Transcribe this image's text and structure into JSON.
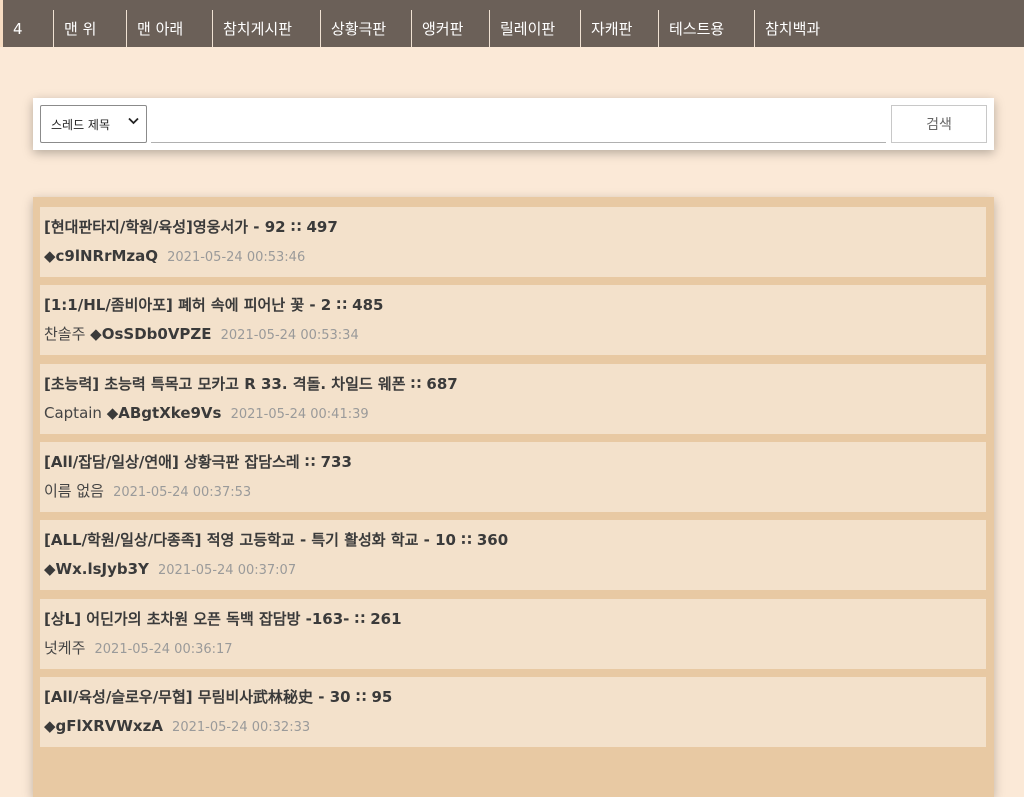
{
  "nav": {
    "items": [
      {
        "label": "4"
      },
      {
        "label": "맨 위"
      },
      {
        "label": "맨 아래"
      },
      {
        "label": "참치게시판"
      },
      {
        "label": "상황극판"
      },
      {
        "label": "앵커판"
      },
      {
        "label": "릴레이판"
      },
      {
        "label": "자캐판"
      },
      {
        "label": "테스트용"
      },
      {
        "label": "참치백과"
      }
    ]
  },
  "search": {
    "select_value": "스레드 제목",
    "input_value": "",
    "button_label": "검색"
  },
  "threads": [
    {
      "title": "[현대판타지/학원/육성]영웅서가 - 92 ∷ 497",
      "name": "",
      "trip": "◆c9lNRrMzaQ",
      "date": "2021-05-24 00:53:46"
    },
    {
      "title": "[1:1/HL/좀비아포] 폐허 속에 피어난 꽃 - 2 ∷ 485",
      "name": "찬솔주 ",
      "trip": "◆OsSDb0VPZE",
      "date": "2021-05-24 00:53:34"
    },
    {
      "title": "[초능력] 초능력 특목고 모카고 R 33. 격돌. 차일드 웨폰 ∷ 687",
      "name": "Captain ",
      "trip": "◆ABgtXke9Vs",
      "date": "2021-05-24 00:41:39"
    },
    {
      "title": "[All/잡담/일상/연애] 상황극판 잡담스레 ∷ 733",
      "name": "이름 없음",
      "trip": "",
      "date": "2021-05-24 00:37:53"
    },
    {
      "title": "[ALL/학원/일상/다종족] 적영 고등학교 - 특기 활성화 학교 - 10 ∷ 360",
      "name": "",
      "trip": "◆Wx.lsJyb3Y",
      "date": "2021-05-24 00:37:07"
    },
    {
      "title": "[상L] 어딘가의 초차원 오픈 독백 잡담방 -163- ∷ 261",
      "name": "넛케주",
      "trip": "",
      "date": "2021-05-24 00:36:17"
    },
    {
      "title": "[All/육성/슬로우/무협] 무림비사武林秘史 - 30 ∷ 95",
      "name": "",
      "trip": "◆gFlXRVWxzA",
      "date": "2021-05-24 00:32:33"
    }
  ],
  "colors": {
    "page_bg": "#fbe9d7",
    "topbar_bg": "#6b6058",
    "list_frame": "#e8c9a3",
    "item_bg": "#f3e1cb"
  }
}
